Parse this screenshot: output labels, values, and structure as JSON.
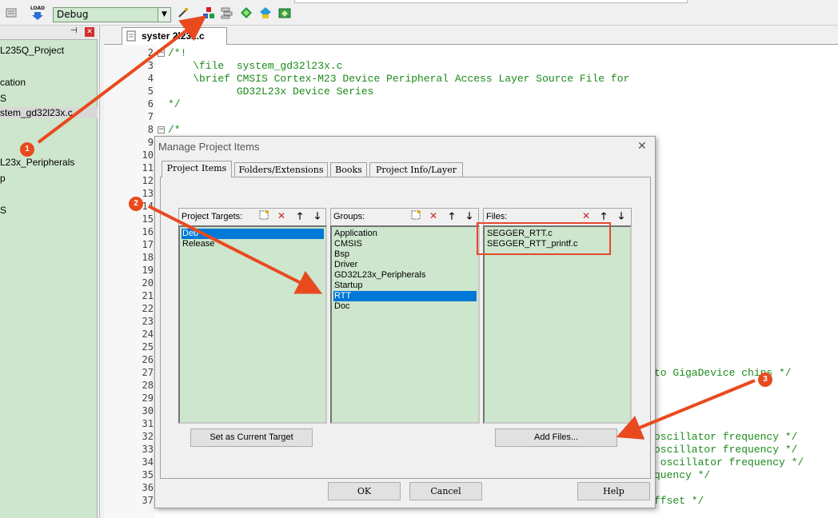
{
  "toolbar": {
    "target_value": "Debug",
    "load_label": "LOAD",
    "icons": [
      "rebuild-icon",
      "load-icon",
      "target-options-icon",
      "manage-project-icon",
      "file-extensions-icon",
      "select-packs-icon",
      "run-time-env-icon"
    ]
  },
  "project_tree": {
    "items": [
      "L235Q_Project",
      "cation",
      "S",
      "stem_gd32l23x.c",
      "L23x_Peripherals",
      "p",
      "S"
    ]
  },
  "editor": {
    "tab_label": "system_gd32l23x.c",
    "tab_visible_label": "syster    2l23x.c",
    "line_numbers": [
      "2",
      "3",
      "4",
      "5",
      "6",
      "7",
      "8",
      "9",
      "10",
      "11",
      "12",
      "13",
      "14",
      "15",
      "16",
      "17",
      "18",
      "19",
      "20",
      "21",
      "22",
      "23",
      "24",
      "25",
      "26",
      "27",
      "28",
      "29",
      "30",
      "31",
      "32",
      "33",
      "34",
      "35",
      "36",
      "37"
    ],
    "code_lines": [
      {
        "text": "/*!"
      },
      {
        "text": "    \\file  system_gd32l23x.c"
      },
      {
        "text": "    \\brief CMSIS Cortex-M23 Device Peripheral Access Layer Source File for"
      },
      {
        "text": "           GD32L23x Device Series"
      },
      {
        "text": "*/"
      },
      {
        "text": "/*"
      }
    ],
    "right_fragments": [
      {
        "text": "to GigaDevice chips */"
      },
      {
        "text": "oscillator frequency */"
      },
      {
        "text": "oscillator frequency */"
      },
      {
        "text": " oscillator frequency */"
      },
      {
        "text": "quency */"
      },
      {
        "text": "ffset */"
      }
    ]
  },
  "dialog": {
    "title": "Manage Project Items",
    "tabs": [
      "Project Items",
      "Folders/Extensions",
      "Books",
      "Project Info/Layer"
    ],
    "targets": {
      "label": "Project Targets:",
      "items": [
        "Debug",
        "Release"
      ],
      "selected": "Debug",
      "visible_items": [
        "Deb",
        "Release"
      ]
    },
    "groups": {
      "label": "Groups:",
      "items": [
        "Application",
        "CMSIS",
        "Bsp",
        "Driver",
        "GD32L23x_Peripherals",
        "Startup",
        "RTT",
        "Doc"
      ],
      "selected": "RTT"
    },
    "files": {
      "label": "Files:",
      "items": [
        "SEGGER_RTT.c",
        "SEGGER_RTT_printf.c"
      ]
    },
    "set_target_button": "Set as Current Target",
    "add_files_button": "Add Files...",
    "ok_button": "OK",
    "cancel_button": "Cancel",
    "help_button": "Help"
  },
  "annotations": {
    "badges": [
      "1",
      "2",
      "3"
    ],
    "accent": "#e84a1e"
  },
  "colors": {
    "list_bg": "#cde6cd",
    "selection": "#0078d7",
    "comment_green": "#1b8a1b"
  }
}
